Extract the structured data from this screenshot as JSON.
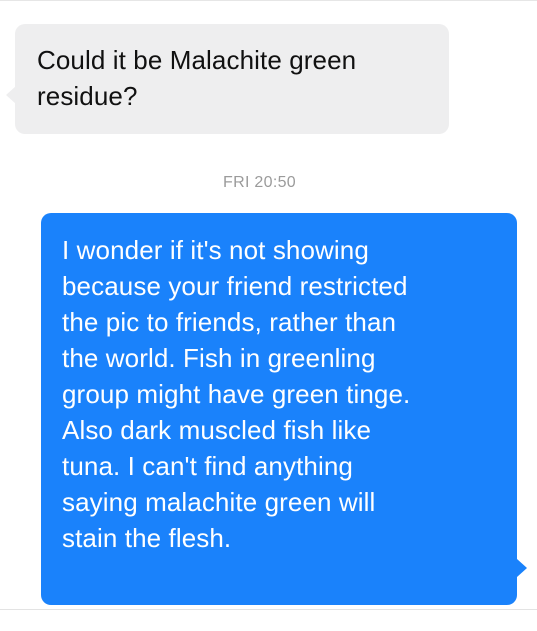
{
  "conversation": {
    "incoming_message": {
      "text": "Could it be Malachite green\nresidue?"
    },
    "timestamp": "FRI 20:50",
    "outgoing_message": {
      "text": "I wonder if it's not showing\nbecause your friend restricted\nthe pic to friends, rather than\nthe world. Fish in greenling\ngroup might have green tinge.\nAlso dark muscled fish like\ntuna. I can't find anything\nsaying malachite green will\nstain the flesh."
    }
  },
  "colors": {
    "incoming_bubble": "#eeeeef",
    "outgoing_bubble": "#1a82fb",
    "timestamp_text": "#9b9b9b",
    "background": "#ffffff"
  }
}
